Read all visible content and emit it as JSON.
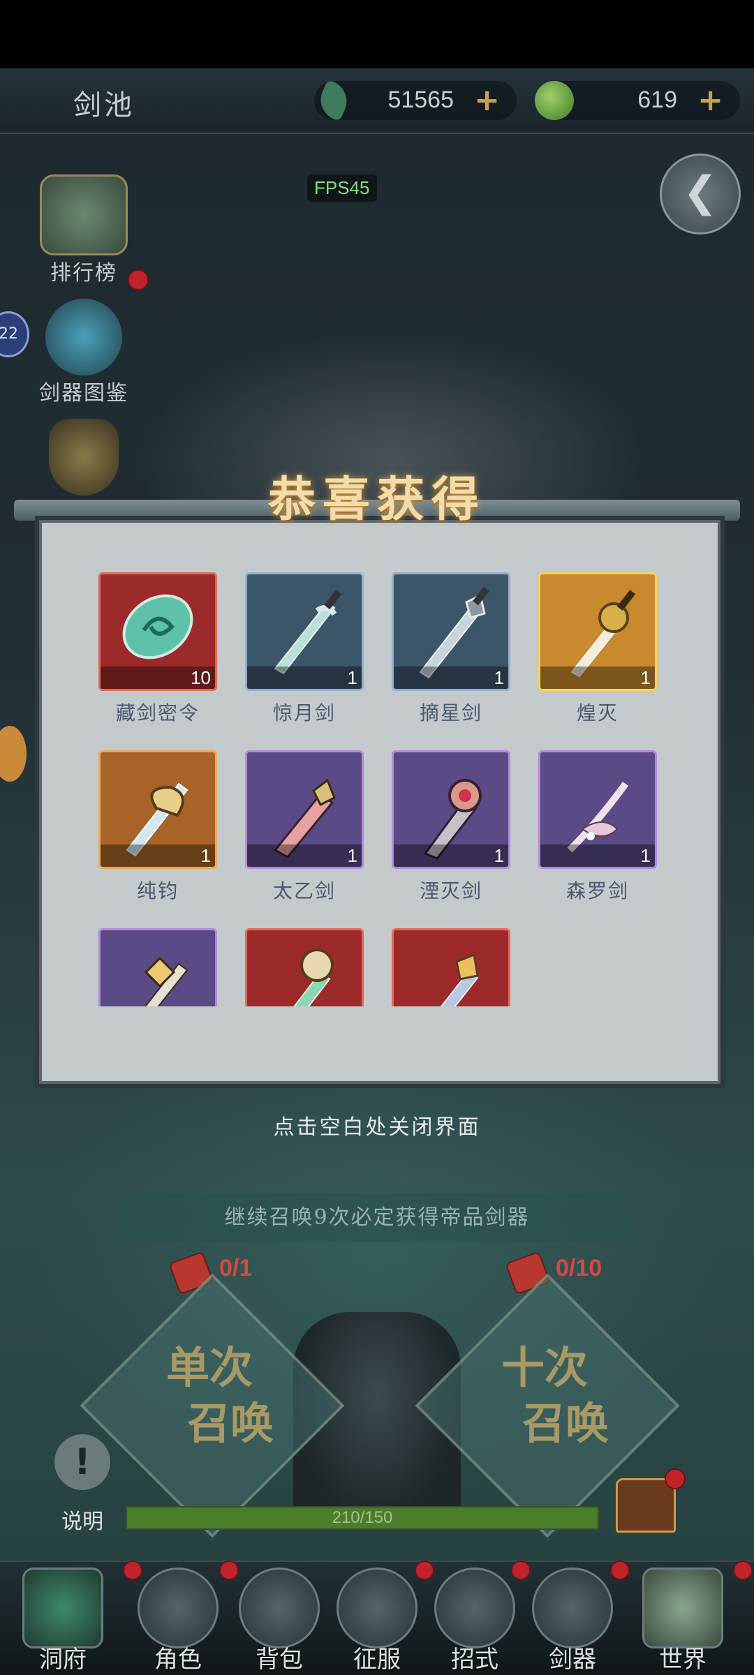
{
  "header": {
    "title": "剑池"
  },
  "resources": [
    {
      "icon": "jade-gem-icon",
      "value": "51565",
      "plus": "+"
    },
    {
      "icon": "jade-coin-icon",
      "value": "619",
      "plus": "+"
    }
  ],
  "fps": "FPS45",
  "sidebar": {
    "items": [
      {
        "label": "排行榜",
        "icon": "leaderboard-icon"
      },
      {
        "label": "剑器图鉴",
        "icon": "sword-codex-icon"
      },
      {
        "label": "",
        "icon": "mask-icon"
      }
    ],
    "level_badge": "22"
  },
  "reward": {
    "title": "恭喜获得",
    "items": [
      {
        "name": "藏剑密令",
        "qty": "10",
        "rarity": "red",
        "icon": "secret-token-icon"
      },
      {
        "name": "惊月剑",
        "qty": "1",
        "rarity": "blue",
        "icon": "sword-icon"
      },
      {
        "name": "摘星剑",
        "qty": "1",
        "rarity": "blue",
        "icon": "sword-icon"
      },
      {
        "name": "煌灭",
        "qty": "1",
        "rarity": "gold",
        "icon": "sword-icon"
      },
      {
        "name": "纯钧",
        "qty": "1",
        "rarity": "orange",
        "icon": "sword-icon"
      },
      {
        "name": "太乙剑",
        "qty": "1",
        "rarity": "purple",
        "icon": "sword-icon"
      },
      {
        "name": "湮灭剑",
        "qty": "1",
        "rarity": "purple",
        "icon": "sword-icon"
      },
      {
        "name": "森罗剑",
        "qty": "1",
        "rarity": "purple",
        "icon": "sword-icon"
      },
      {
        "name": "",
        "qty": "",
        "rarity": "purple",
        "icon": "sword-icon"
      },
      {
        "name": "",
        "qty": "",
        "rarity": "red",
        "icon": "sword-icon"
      },
      {
        "name": "",
        "qty": "",
        "rarity": "red",
        "icon": "sword-icon"
      }
    ],
    "close_hint": "点击空白处关闭界面"
  },
  "summon": {
    "pity_text": "继续召唤9次必定获得帝品剑器",
    "single": {
      "count": "0/1",
      "label_line1": "单次",
      "label_line2": "召唤"
    },
    "ten": {
      "count": "0/10",
      "label_line1": "十次",
      "label_line2": "召唤"
    }
  },
  "help": {
    "label": "说明",
    "icon": "exclamation-icon"
  },
  "progress": {
    "text": "210/150",
    "fraction": 1.0
  },
  "colors": {
    "red": "#9c2a2a",
    "blue": "#3d5568",
    "gold": "#c98a2e",
    "orange": "#a86428",
    "purple": "#5a4a86",
    "accent": "#c8a14a"
  },
  "nav": [
    {
      "label": "洞府",
      "icon": "cave-dwelling-icon"
    },
    {
      "label": "角色",
      "icon": "character-icon"
    },
    {
      "label": "背包",
      "icon": "backpack-icon"
    },
    {
      "label": "征服",
      "icon": "crossed-swords-icon"
    },
    {
      "label": "招式",
      "icon": "scroll-icon"
    },
    {
      "label": "剑器",
      "icon": "sword-spirit-icon"
    },
    {
      "label": "世界",
      "icon": "world-map-icon"
    }
  ]
}
